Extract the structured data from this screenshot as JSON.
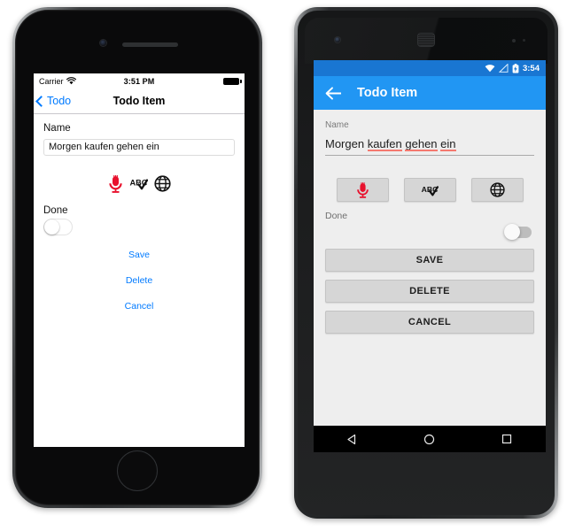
{
  "iphone": {
    "status_bar": {
      "carrier": "Carrier",
      "wifi_icon": "wifi-icon",
      "time": "3:51 PM",
      "battery_icon": "battery-icon"
    },
    "nav_bar": {
      "back_icon": "chevron-left-icon",
      "back_label": "Todo",
      "title": "Todo Item"
    },
    "form": {
      "name_label": "Name",
      "name_value": "Morgen kaufen gehen ein",
      "name_placeholder": "Name",
      "done_label": "Done",
      "done_checked": false
    },
    "icon_buttons": [
      {
        "name": "microphone-icon",
        "label": "Speech to text"
      },
      {
        "name": "spellcheck-icon",
        "label": "Spell check"
      },
      {
        "name": "globe-icon",
        "label": "Translate"
      }
    ],
    "actions": [
      {
        "name": "save-button",
        "label": "Save"
      },
      {
        "name": "delete-button",
        "label": "Delete"
      },
      {
        "name": "cancel-button",
        "label": "Cancel"
      }
    ],
    "hardware": {
      "home_button": "home-button",
      "camera": "front-camera",
      "speaker": "earpiece-speaker"
    }
  },
  "android": {
    "status_bar": {
      "wifi_icon": "wifi-icon",
      "signal_icon": "signal-icon",
      "battery_icon": "battery-charging-icon",
      "time": "3:54"
    },
    "app_bar": {
      "back_icon": "arrow-left-icon",
      "title": "Todo Item"
    },
    "form": {
      "name_label": "Name",
      "name_value_words": [
        "Morgen",
        "kaufen",
        "gehen",
        "ein"
      ],
      "name_value": "Morgen kaufen gehen ein",
      "misspelled": [
        "kaufen",
        "gehen",
        "ein"
      ],
      "done_label": "Done",
      "done_checked": false
    },
    "icon_buttons": [
      {
        "name": "microphone-icon",
        "label": "Speech to text"
      },
      {
        "name": "spellcheck-icon",
        "label": "Spell check"
      },
      {
        "name": "globe-icon",
        "label": "Translate"
      }
    ],
    "actions": [
      {
        "name": "save-button",
        "label": "SAVE"
      },
      {
        "name": "delete-button",
        "label": "DELETE"
      },
      {
        "name": "cancel-button",
        "label": "CANCEL"
      }
    ],
    "nav_bar": [
      {
        "name": "android-back-icon",
        "label": "Back"
      },
      {
        "name": "android-home-icon",
        "label": "Home"
      },
      {
        "name": "android-recents-icon",
        "label": "Recents"
      }
    ]
  },
  "colors": {
    "ios_tint": "#007aff",
    "android_primary": "#2196f3",
    "android_primary_dark": "#1976d2",
    "mic_red": "#e8112d",
    "spell_underline": "#f4796f",
    "android_bg": "#eeeeee",
    "android_button": "#d6d6d6"
  }
}
